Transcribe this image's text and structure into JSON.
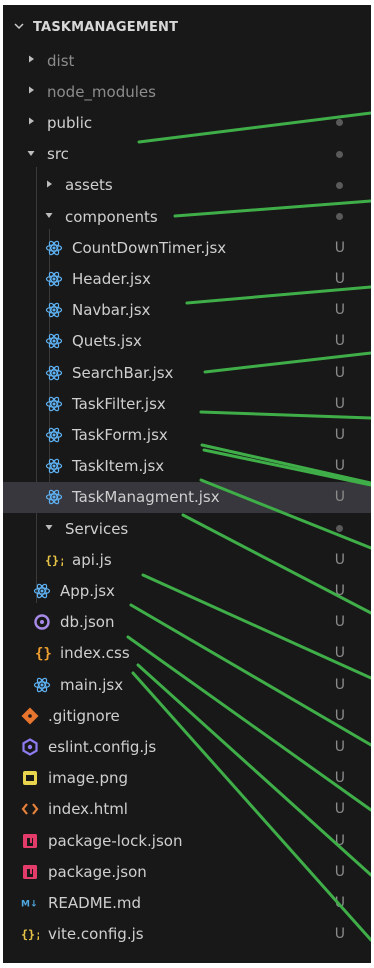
{
  "explorer": {
    "project_name": "TASKMANAGEMENT"
  },
  "tree": [
    {
      "label": "dist",
      "type": "folder",
      "state": "collapsed",
      "depth": 0,
      "icon": "caret-right-icon",
      "status": ""
    },
    {
      "label": "node_modules",
      "type": "folder",
      "state": "collapsed",
      "depth": 0,
      "icon": "caret-right-icon",
      "status": ""
    },
    {
      "label": "public",
      "type": "folder",
      "state": "collapsed",
      "depth": 0,
      "icon": "caret-right-icon",
      "status": "dot"
    },
    {
      "label": "src",
      "type": "folder",
      "state": "expanded",
      "depth": 0,
      "icon": "caret-down-icon",
      "status": "dot"
    },
    {
      "label": "assets",
      "type": "folder",
      "state": "collapsed",
      "depth": 1,
      "icon": "caret-right-icon",
      "status": "dot"
    },
    {
      "label": "components",
      "type": "folder",
      "state": "expanded",
      "depth": 1,
      "icon": "caret-down-icon",
      "status": "dot"
    },
    {
      "label": "CountDownTimer.jsx",
      "type": "file",
      "depth": 2,
      "icon": "react-icon",
      "status": "U"
    },
    {
      "label": "Header.jsx",
      "type": "file",
      "depth": 2,
      "icon": "react-icon",
      "status": "U"
    },
    {
      "label": "Navbar.jsx",
      "type": "file",
      "depth": 2,
      "icon": "react-icon",
      "status": "U"
    },
    {
      "label": "Quets.jsx",
      "type": "file",
      "depth": 2,
      "icon": "react-icon",
      "status": "U"
    },
    {
      "label": "SearchBar.jsx",
      "type": "file",
      "depth": 2,
      "icon": "react-icon",
      "status": "U"
    },
    {
      "label": "TaskFilter.jsx",
      "type": "file",
      "depth": 2,
      "icon": "react-icon",
      "status": "U"
    },
    {
      "label": "TaskForm.jsx",
      "type": "file",
      "depth": 2,
      "icon": "react-icon",
      "status": "U"
    },
    {
      "label": "TaskItem.jsx",
      "type": "file",
      "depth": 2,
      "icon": "react-icon",
      "status": "U"
    },
    {
      "label": "TaskManagment.jsx",
      "type": "file",
      "depth": 2,
      "icon": "react-icon",
      "status": "U",
      "selected": true
    },
    {
      "label": "Services",
      "type": "folder",
      "state": "expanded",
      "depth": 1,
      "icon": "caret-down-icon",
      "status": "dot"
    },
    {
      "label": "api.js",
      "type": "file",
      "depth": 2,
      "icon": "js-icon",
      "status": "U"
    },
    {
      "label": "App.jsx",
      "type": "file",
      "depth": 1,
      "icon": "react-icon",
      "status": "U"
    },
    {
      "label": "db.json",
      "type": "file",
      "depth": 1,
      "icon": "json-ring-icon",
      "status": "U"
    },
    {
      "label": "index.css",
      "type": "file",
      "depth": 1,
      "icon": "css-braces-icon",
      "status": "U"
    },
    {
      "label": "main.jsx",
      "type": "file",
      "depth": 1,
      "icon": "react-icon",
      "status": "U"
    },
    {
      "label": ".gitignore",
      "type": "file",
      "depth": 0,
      "icon": "git-icon",
      "status": "U"
    },
    {
      "label": "eslint.config.js",
      "type": "file",
      "depth": 0,
      "icon": "eslint-icon",
      "status": "U"
    },
    {
      "label": "image.png",
      "type": "file",
      "depth": 0,
      "icon": "image-icon",
      "status": "U"
    },
    {
      "label": "index.html",
      "type": "file",
      "depth": 0,
      "icon": "html-icon",
      "status": "U"
    },
    {
      "label": "package-lock.json",
      "type": "file",
      "depth": 0,
      "icon": "npm-icon",
      "status": "U"
    },
    {
      "label": "package.json",
      "type": "file",
      "depth": 0,
      "icon": "npm-icon",
      "status": "U"
    },
    {
      "label": "README.md",
      "type": "file",
      "depth": 0,
      "icon": "markdown-icon",
      "status": "U"
    },
    {
      "label": "vite.config.js",
      "type": "file",
      "depth": 0,
      "icon": "js-icon",
      "status": "U"
    }
  ],
  "colors": {
    "background": "#181818",
    "selected_row": "#37373d",
    "react": "#5fb3f5",
    "js": "#e8c547",
    "css": "#f0a030",
    "json_ring": "#a88ae8",
    "git": "#e7752d",
    "npm": "#e43c6a",
    "markdown": "#4fa7e0",
    "image": "#e8d44d",
    "html": "#e8813a",
    "annotation_line": "#3fae48",
    "green_text": "#73c991"
  }
}
